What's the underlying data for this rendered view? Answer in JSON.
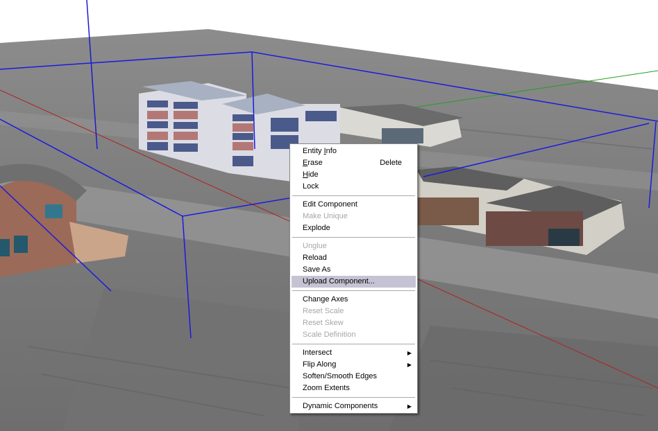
{
  "context_menu": {
    "entity_info": {
      "pre": "Entity ",
      "u": "I",
      "post": "nfo"
    },
    "erase": {
      "u": "E",
      "post": "rase",
      "shortcut": "Delete"
    },
    "hide": {
      "u": "H",
      "post": "ide"
    },
    "lock": "Lock",
    "edit_component": "Edit Component",
    "make_unique": "Make Unique",
    "explode": "Explode",
    "unglue": "Unglue",
    "reload": "Reload",
    "save_as": "Save As",
    "upload_component": "Upload Component...",
    "change_axes": "Change Axes",
    "reset_scale": "Reset Scale",
    "reset_skew": "Reset Skew",
    "scale_definition": "Scale Definition",
    "intersect": "Intersect",
    "flip_along": "Flip Along",
    "soften_smooth_edges": "Soften/Smooth Edges",
    "zoom_extents": "Zoom Extents",
    "dynamic_components": "Dynamic Components"
  },
  "colors": {
    "bounding_box": "#1a1ae0",
    "red_axis": "#b02020",
    "green_axis": "#1fa01f",
    "blue_axis": "#1a1ad0",
    "menu_highlight": "#c5c3d3"
  }
}
